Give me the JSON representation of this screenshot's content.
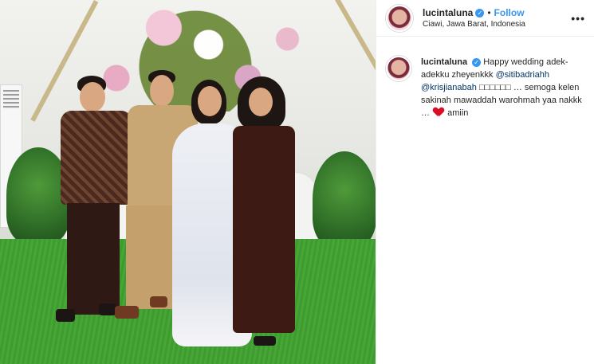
{
  "header": {
    "username": "lucintaluna",
    "separator": "•",
    "follow_label": "Follow",
    "location": "Ciawi, Jawa Barat, Indonesia",
    "more_label": "•••"
  },
  "caption": {
    "username": "lucintaluna",
    "text_1": "Happy wedding adek-adekku zheyenkkk",
    "mention_1": "@sitibadriahh",
    "mention_2": "@krisjianabah",
    "boxes": "□□□□□□",
    "text_2": "… semoga kelen sakinah mawaddah warohmah yaa nakkk …",
    "text_3": "amiin"
  },
  "colors": {
    "link_blue": "#3897f0",
    "mention": "#003569",
    "heart": "#d80f26"
  },
  "icons": {
    "verified": "verified-badge-icon",
    "more": "more-options-icon",
    "heart": "heart-icon"
  }
}
